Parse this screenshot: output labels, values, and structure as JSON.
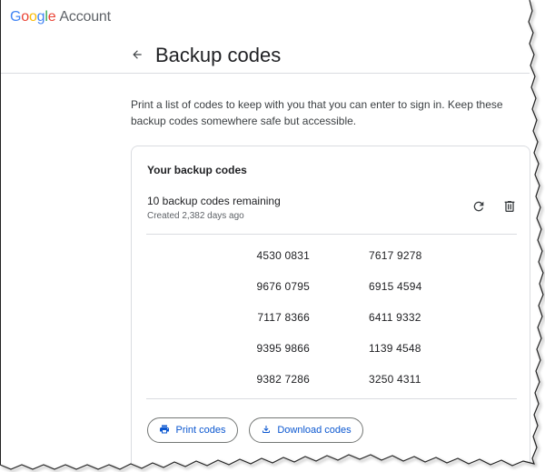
{
  "header": {
    "logo_google": "Google",
    "logo_account": "Account"
  },
  "page": {
    "title": "Backup codes",
    "intro": "Print a list of codes to keep with you that you can enter to sign in. Keep these backup codes somewhere safe but accessible."
  },
  "card": {
    "title": "Your backup codes",
    "remaining": "10 backup codes remaining",
    "created": "Created 2,382 days ago",
    "codes_left": [
      "4530 0831",
      "9676 0795",
      "7117 8366",
      "9395 9866",
      "9382 7286"
    ],
    "codes_right": [
      "7617 9278",
      "6915 4594",
      "6411 9332",
      "1139 4548",
      "3250 4311"
    ],
    "print_label": "Print codes",
    "download_label": "Download codes"
  },
  "icons": {
    "back": "arrow-back-icon",
    "refresh": "refresh-icon",
    "delete": "trash-icon",
    "print": "printer-icon",
    "download": "download-icon"
  },
  "colors": {
    "accent": "#0b57d0",
    "text": "#202124",
    "muted": "#5f6368",
    "border": "#dadce0",
    "google_blue": "#4285f4",
    "google_red": "#ea4335",
    "google_yellow": "#fbbc05",
    "google_green": "#34a853"
  }
}
